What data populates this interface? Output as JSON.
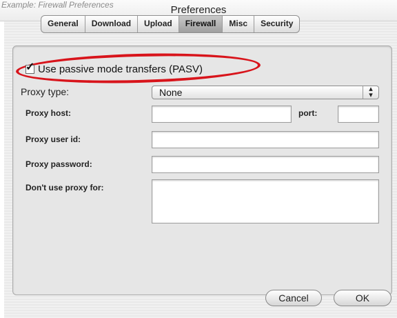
{
  "window": {
    "caption_fragment": "Example: Firewall Preferences",
    "title": "Preferences"
  },
  "tabs": [
    {
      "label": "General",
      "active": false
    },
    {
      "label": "Download",
      "active": false
    },
    {
      "label": "Upload",
      "active": false
    },
    {
      "label": "Firewall",
      "active": true
    },
    {
      "label": "Misc",
      "active": false
    },
    {
      "label": "Security",
      "active": false
    }
  ],
  "passive_mode": {
    "label": "Use passive mode transfers (PASV)",
    "checked": true,
    "check_glyph": "✓",
    "highlight_color": "#d8141b"
  },
  "proxy": {
    "type_label": "Proxy type:",
    "type_value": "None",
    "host_label": "Proxy host:",
    "host_value": "",
    "port_label": "port:",
    "port_value": "",
    "user_label": "Proxy user id:",
    "user_value": "",
    "password_label": "Proxy password:",
    "password_value": "",
    "exclude_label": "Don't use proxy for:",
    "exclude_value": ""
  },
  "buttons": {
    "cancel": "Cancel",
    "ok": "OK"
  }
}
